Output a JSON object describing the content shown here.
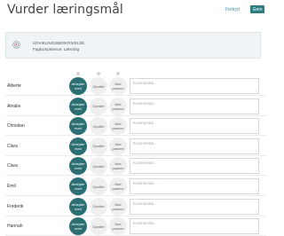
{
  "header": {
    "title": "Vurder læringsmål",
    "cancel_label": "Fortryd",
    "save_label": "Gem"
  },
  "goal": {
    "title": "UDVIKLINGSBESKRIVELSE",
    "subtitle": "Fagkompetence: Læsning",
    "icon": "target-icon"
  },
  "options": {
    "a": "Arbejder med",
    "b": "Opnået",
    "c": "Ikke paavne"
  },
  "comment_placeholder": "Kommentar...",
  "colors": {
    "accent": "#2c6f73",
    "save_button": "#2f7d83",
    "link": "#3a8fa0"
  },
  "students": [
    {
      "name": "Alberte"
    },
    {
      "name": "Amalie"
    },
    {
      "name": "Christian"
    },
    {
      "name": "Clara"
    },
    {
      "name": "Clara"
    },
    {
      "name": "Emil"
    },
    {
      "name": "Frederik"
    },
    {
      "name": "Hannah"
    }
  ]
}
